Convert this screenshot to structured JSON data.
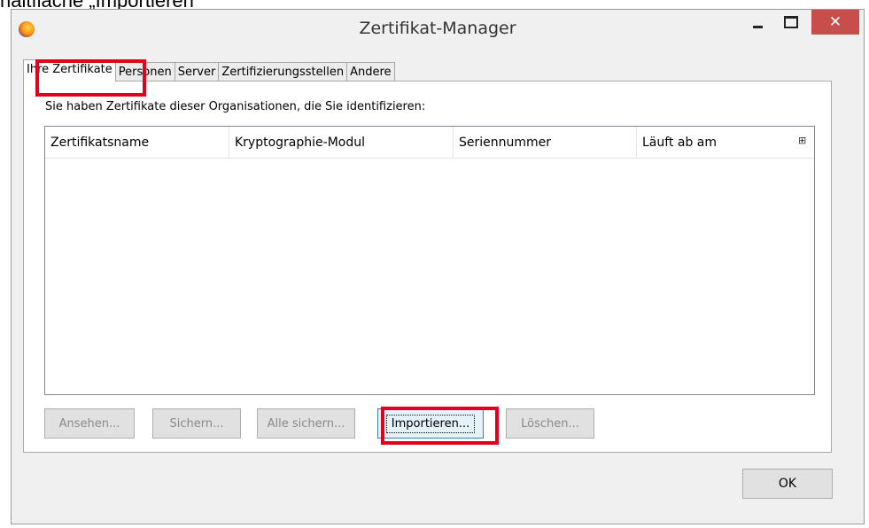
{
  "caption": "haltfläche „Importieren",
  "window": {
    "title": "Zertifikat-Manager",
    "close_glyph": "✕"
  },
  "tabs": [
    {
      "label": "Ihre Zertifikate",
      "active": true
    },
    {
      "label": "Personen",
      "active": false
    },
    {
      "label": "Server",
      "active": false
    },
    {
      "label": "Zertifizierungsstellen",
      "active": false
    },
    {
      "label": "Andere",
      "active": false
    }
  ],
  "panel": {
    "intro_text": "Sie haben Zertifikate dieser Organisationen, die Sie identifizieren:",
    "columns": [
      "Zertifikatsname",
      "Kryptographie-Modul",
      "Seriennummer",
      "Läuft ab am"
    ],
    "column_picker_glyph": "⊞",
    "rows": []
  },
  "buttons": {
    "view": "Ansehen...",
    "backup": "Sichern...",
    "backup_all": "Alle sichern...",
    "import": "Importieren...",
    "delete": "Löschen...",
    "ok": "OK"
  },
  "colors": {
    "highlight": "#e3001b",
    "close_button": "#c74e4a"
  },
  "icons": {
    "app": "firefox-icon"
  }
}
